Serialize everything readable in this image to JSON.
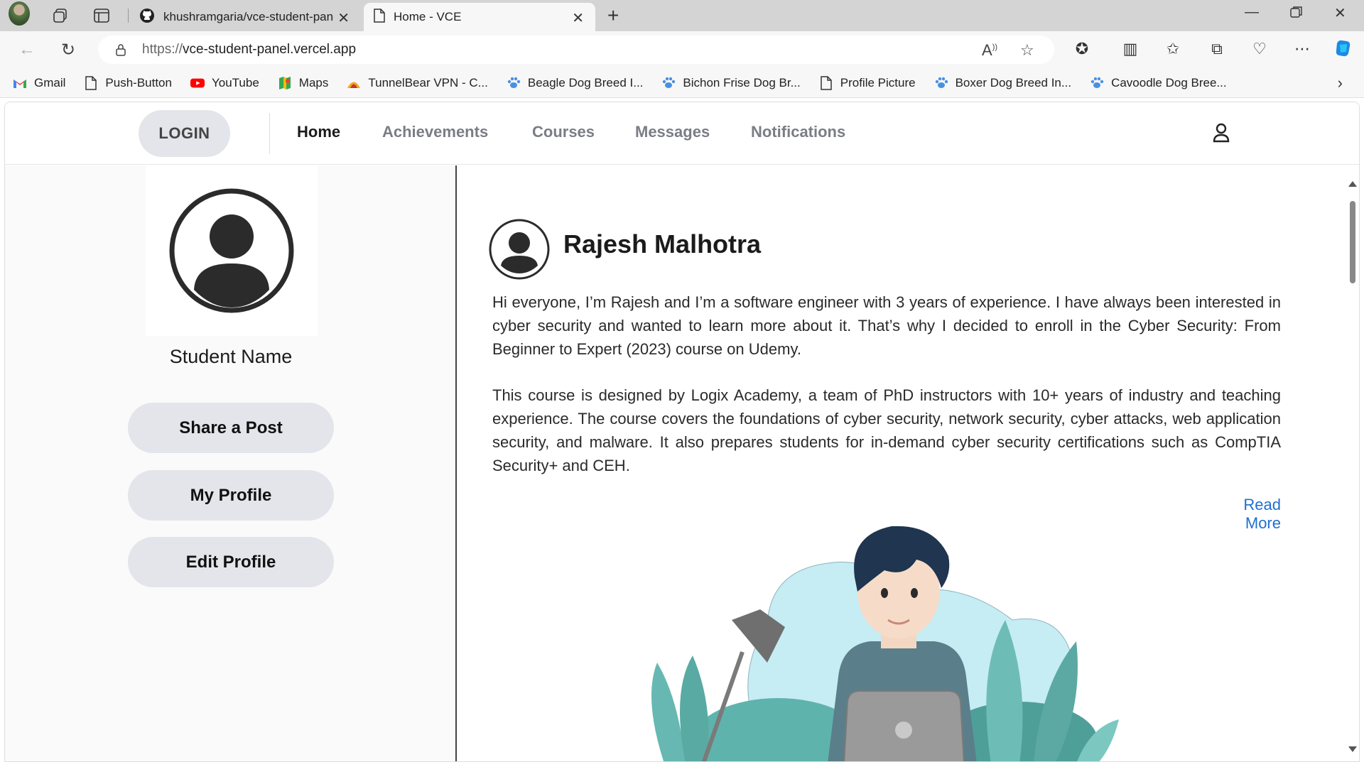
{
  "browser": {
    "tabs": [
      {
        "title": "khushramgaria/vce-student-panel",
        "icon": "github-icon"
      },
      {
        "title": "Home - VCE",
        "icon": "page-icon"
      }
    ],
    "url_scheme": "https://",
    "url_host": "vce-student-panel.vercel.app",
    "bookmarks": [
      {
        "label": "Gmail",
        "icon": "gmail-icon"
      },
      {
        "label": "Push-Button",
        "icon": "page-icon"
      },
      {
        "label": "YouTube",
        "icon": "youtube-icon"
      },
      {
        "label": "Maps",
        "icon": "maps-icon"
      },
      {
        "label": "TunnelBear VPN - C...",
        "icon": "tunnelbear-icon"
      },
      {
        "label": "Beagle Dog Breed I...",
        "icon": "paw-icon"
      },
      {
        "label": "Bichon Frise Dog Br...",
        "icon": "paw-icon"
      },
      {
        "label": "Profile Picture",
        "icon": "page-icon"
      },
      {
        "label": "Boxer Dog Breed In...",
        "icon": "paw-icon"
      },
      {
        "label": "Cavoodle Dog Bree...",
        "icon": "paw-icon"
      }
    ]
  },
  "nav": {
    "login": "LOGIN",
    "links": [
      "Home",
      "Achievements",
      "Courses",
      "Messages",
      "Notifications"
    ],
    "active": "Home"
  },
  "sidebar": {
    "student_name": "Student Name",
    "buttons": [
      "Share a Post",
      "My Profile",
      "Edit Profile"
    ]
  },
  "post": {
    "author": "Rajesh Malhotra",
    "paragraph1": "Hi everyone, I’m Rajesh and I’m a software engineer with 3 years of experience. I have always been interested in cyber security and wanted to learn more about it. That’s why I decided to enroll in the Cyber Security: From Beginner to Expert (2023) course on Udemy.",
    "paragraph2": "This course is designed by Logix Academy, a team of PhD instructors with 10+ years of industry and teaching experience. The course covers the foundations of cyber security, network security, cyber attacks, web application security, and malware. It also prepares students for in-demand cyber security certifications such as CompTIA Security+ and CEH.",
    "read_more": "Read More"
  },
  "colors": {
    "accent_link": "#1f6fd1",
    "button_bg": "#e4e5ea",
    "nav_inactive": "#7a7d86"
  }
}
